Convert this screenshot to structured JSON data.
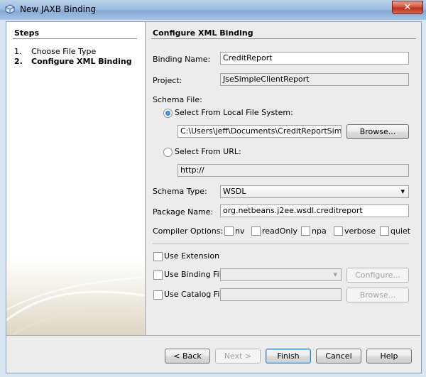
{
  "window": {
    "title": "New JAXB Binding",
    "close_icon": "close-icon"
  },
  "steps": {
    "heading": "Steps",
    "items": [
      {
        "num": "1.",
        "label": "Choose File Type",
        "current": false
      },
      {
        "num": "2.",
        "label": "Configure XML Binding",
        "current": true
      }
    ]
  },
  "main": {
    "heading": "Configure XML Binding",
    "binding_name": {
      "label": "Binding Name:",
      "value": "CreditReport"
    },
    "project": {
      "label": "Project:",
      "value": "JseSimpleClientReport"
    },
    "schema_file": {
      "label": "Schema File:",
      "local": {
        "label": "Select From Local File System:",
        "selected": true,
        "value": "C:\\Users\\jeff\\Documents\\CreditReportSimple.w",
        "browse": "Browse..."
      },
      "url": {
        "label": "Select From URL:",
        "selected": false,
        "value": "http://"
      }
    },
    "schema_type": {
      "label": "Schema Type:",
      "value": "WSDL"
    },
    "package_name": {
      "label": "Package Name:",
      "value": "org.netbeans.j2ee.wsdl.creditreport"
    },
    "compiler_options": {
      "label": "Compiler Options:",
      "options": [
        {
          "label": "nv",
          "checked": false
        },
        {
          "label": "readOnly",
          "checked": false
        },
        {
          "label": "npa",
          "checked": false
        },
        {
          "label": "verbose",
          "checked": false
        },
        {
          "label": "quiet",
          "checked": false
        }
      ]
    },
    "use_extension": {
      "label": "Use Extension",
      "checked": false
    },
    "use_binding_file": {
      "label": "Use Binding File",
      "checked": false,
      "button": "Configure..."
    },
    "use_catalog_file": {
      "label": "Use Catalog File",
      "checked": false,
      "button": "Browse..."
    }
  },
  "footer": {
    "back": "< Back",
    "next": "Next >",
    "finish": "Finish",
    "cancel": "Cancel",
    "help": "Help"
  }
}
